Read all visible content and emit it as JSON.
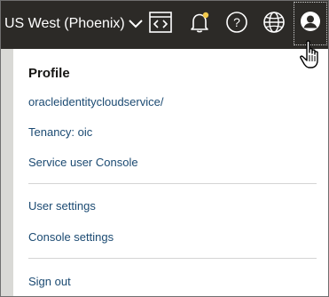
{
  "topbar": {
    "region_label": "US West (Phoenix)",
    "icons": {
      "region_chevron": "chevron-down-icon",
      "code_editor": "code-editor-icon",
      "notifications": "bell-icon",
      "help": "help-icon",
      "language": "globe-icon",
      "profile": "user-avatar-icon"
    },
    "notification_dot_color": "#f2c94c"
  },
  "profile_menu": {
    "title": "Profile",
    "sections": [
      {
        "items": [
          {
            "label": "oracleidentitycloudservice/"
          },
          {
            "label": "Tenancy: oic"
          },
          {
            "label": "Service user Console"
          }
        ]
      },
      {
        "items": [
          {
            "label": "User settings"
          },
          {
            "label": "Console settings"
          }
        ]
      },
      {
        "items": [
          {
            "label": "Sign out"
          }
        ]
      }
    ]
  },
  "colors": {
    "topbar_bg": "#2c2a27",
    "link": "#1b4a72"
  }
}
